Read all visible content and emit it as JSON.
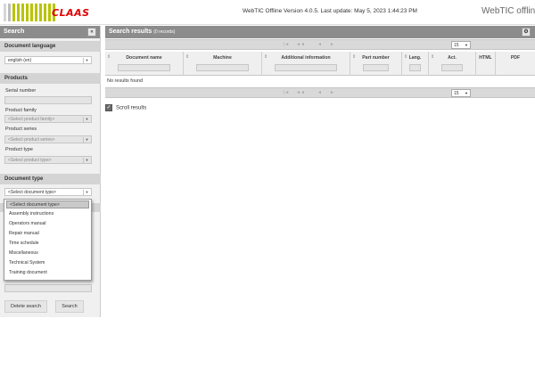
{
  "header": {
    "logo_text": "CLAAS",
    "version_text": "WebTIC Offline Version 4.0.5. Last update: May 5, 2023 1:44:23 PM",
    "brand_text": "WebTIC offline",
    "accent_color": "#b8c400",
    "logo_color": "#e10000"
  },
  "sidebar": {
    "title": "Search",
    "collapse_icon": "«",
    "document_language": {
      "title": "Document language",
      "value": "english (en)"
    },
    "products": {
      "title": "Products",
      "serial_label": "Serial number",
      "family_label": "Product family",
      "family_placeholder": "<Select product family>",
      "series_label": "Product series",
      "series_placeholder": "<Select product series>",
      "type_label": "Product type",
      "type_placeholder": "<Select product type>"
    },
    "document_type": {
      "title": "Document type",
      "value": "<Select document type>",
      "options": [
        "<Select document type>",
        "Assembly instructions",
        "Operators manual",
        "Repair manual",
        "Time schedule",
        "Miscellaneous",
        "Technical System",
        "Training document"
      ]
    },
    "buttons": {
      "delete": "Delete search",
      "search": "Search"
    }
  },
  "main": {
    "title": "Search results",
    "count": "(0 records)",
    "gear_icon": "gear-icon",
    "pager": {
      "first": "|◄",
      "prev_fast": "◄◄",
      "prev": "◄",
      "next": "►",
      "last": "►|",
      "page_size": "15"
    },
    "columns": [
      "Document name",
      "Machine",
      "Additional information",
      "Part number",
      "Lang.",
      "Act.",
      "HTML",
      "PDF"
    ],
    "no_results": "No results found",
    "scroll_label": "Scroll results"
  }
}
